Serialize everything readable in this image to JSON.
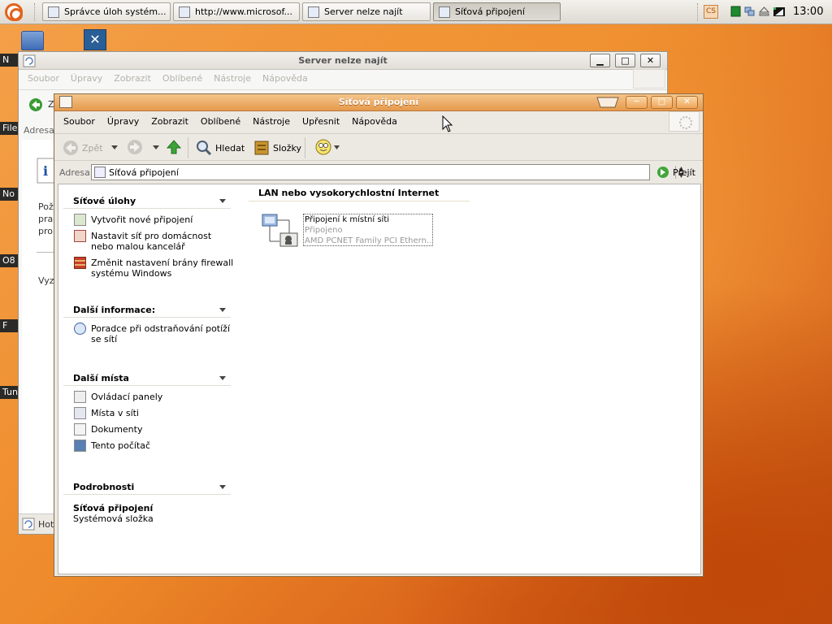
{
  "panel": {
    "tasks": [
      {
        "label": "Správce úloh systém...",
        "icon": "task-manager-icon"
      },
      {
        "label": "http://www.microsof...",
        "icon": "browser-page-icon"
      },
      {
        "label": "Server nelze najít",
        "icon": "browser-page-icon"
      },
      {
        "label": "Síťová připojení",
        "icon": "network-connections-icon",
        "active": true
      }
    ],
    "keyboard_layout": "CS",
    "clock": "13:00"
  },
  "desktop": {
    "labels": [
      "N",
      "File",
      "No",
      "O8",
      "F",
      "Tune"
    ]
  },
  "back_window": {
    "title": "Server nelze najít",
    "menu": [
      "Soubor",
      "Úpravy",
      "Zobrazit",
      "Oblíbené",
      "Nástroje",
      "Nápověda"
    ],
    "address_label": "Adresa",
    "body_fragments": [
      "Z",
      "Pož",
      "pra",
      "pro",
      "Vyz",
      "Hoto"
    ],
    "controls": {
      "minimize": "▁",
      "maximize": "□",
      "close": "✕"
    }
  },
  "window": {
    "title": "Síťová připojení",
    "controls": {
      "minimize": "─",
      "maximize": "□",
      "close": "✕"
    },
    "menu": [
      "Soubor",
      "Úpravy",
      "Zobrazit",
      "Oblíbené",
      "Nástroje",
      "Upřesnit",
      "Nápověda"
    ],
    "toolbar": {
      "back": "Zpět",
      "search": "Hledat",
      "folders": "Složky"
    },
    "address": {
      "label": "Adresa",
      "value": "Síťová připojení",
      "go": "Přejít"
    },
    "task_groups": [
      {
        "title": "Síťové úlohy",
        "items": [
          {
            "label": "Vytvořit nové připojení",
            "icon": "new-connection-icon"
          },
          {
            "label": "Nastavit síť pro domácnost nebo malou kancelář",
            "icon": "home-network-icon"
          },
          {
            "label": "Změnit nastavení brány firewall systému Windows",
            "icon": "firewall-icon"
          }
        ]
      },
      {
        "title": "Další informace:",
        "items": [
          {
            "label": "Poradce při odstraňování potíží se sítí",
            "icon": "info-icon"
          }
        ]
      },
      {
        "title": "Další místa",
        "items": [
          {
            "label": "Ovládací panely",
            "icon": "control-panel-icon"
          },
          {
            "label": "Místa v síti",
            "icon": "network-places-icon"
          },
          {
            "label": "Dokumenty",
            "icon": "documents-icon"
          },
          {
            "label": "Tento počítač",
            "icon": "my-computer-icon"
          }
        ]
      },
      {
        "title": "Podrobnosti",
        "details_title": "Síťová připojení",
        "details_sub": "Systémová složka"
      }
    ],
    "lan_section": {
      "title": "LAN nebo vysokorychlostní Internet",
      "connection": {
        "name": "Připojení k místní síti",
        "status": "Připojeno",
        "device": "AMD PCNET Family PCI Ethern..."
      }
    }
  }
}
